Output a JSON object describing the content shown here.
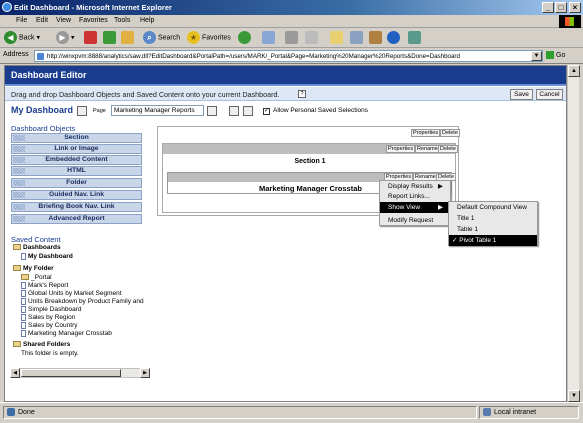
{
  "window": {
    "title": "Edit Dashboard - Microsoft Internet Explorer",
    "controls": {
      "minimize": "_",
      "maximize": "□",
      "close": "×"
    }
  },
  "menubar": [
    "File",
    "Edit",
    "View",
    "Favorites",
    "Tools",
    "Help"
  ],
  "toolbar": {
    "back": "Back",
    "search": "Search",
    "favorites": "Favorites"
  },
  "address": {
    "label": "Address",
    "url": "http://winxpvm:8888/analytics/saw.dll?EditDashboard&PortalPath=/users/MARK/_Portal&Page=Marketing%20Manager%20Reports&Done=Dashboard",
    "go": "Go"
  },
  "editor": {
    "title": "Dashboard Editor",
    "instruction": "Drag and drop Dashboard Objects and Saved Content onto your current Dashboard.",
    "save": "Save",
    "cancel": "Cancel",
    "dashboard_name": "My Dashboard",
    "page_label": "Page",
    "page_select": "Marketing Manager Reports",
    "allow_label": "Allow Personal Saved Selections",
    "allow_checked": "✓"
  },
  "objects": {
    "title": "Dashboard Objects",
    "items": [
      "Section",
      "Link or Image",
      "Embedded Content",
      "HTML",
      "Folder",
      "Guided Nav. Link",
      "Briefing Book Nav. Link",
      "Advanced Report"
    ]
  },
  "saved": {
    "title": "Saved Content",
    "dashboards": "Dashboards",
    "my_dashboard": "My Dashboard",
    "my_folder": "My Folder",
    "folder_items": [
      "_Portal",
      "Mark's Report",
      "Global Units by Market Segment",
      "Units Breakdown by Product Family and",
      "Simple Dashboard",
      "Sales by Region",
      "Sales by Country",
      "Marketing Manager Crosstab"
    ],
    "shared": "Shared Folders",
    "empty": "This folder is empty."
  },
  "canvas": {
    "page_props": "Properties",
    "page_delete": "Delete",
    "sec_props": "Properties",
    "sec_rename": "Rename",
    "sec_delete": "Delete",
    "section_label": "Section 1",
    "rep_props": "Properties",
    "rep_rename": "Rename",
    "rep_delete": "Delete",
    "report_label": "Marketing Manager Crosstab"
  },
  "context_menu": [
    "Display Results",
    "Report Links...",
    "Show View",
    "Modify Request"
  ],
  "submenu": [
    "Default Compound View",
    "Title 1",
    "Table 1",
    "Pivot Table 1"
  ],
  "status": {
    "left": "Done",
    "zone": "Local intranet"
  }
}
